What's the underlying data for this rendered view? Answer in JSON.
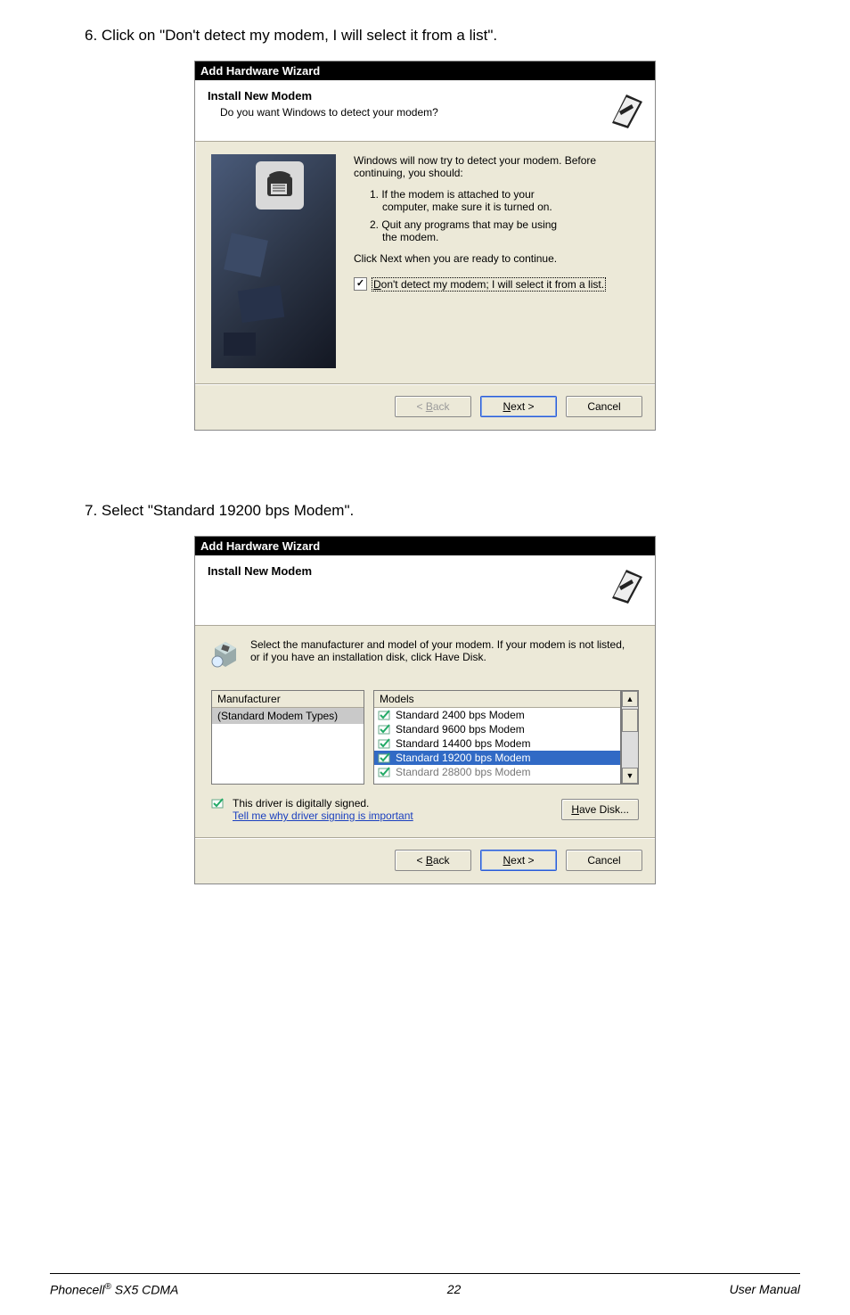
{
  "steps": {
    "s6": "6. Click on \"Don't detect my modem, I will select it from a list\".",
    "s7": "7. Select \"Standard 19200 bps Modem\"."
  },
  "dialog1": {
    "titlebar": "Add Hardware Wizard",
    "header_title": "Install New Modem",
    "header_sub": "Do you want Windows to detect your modem?",
    "intro": "Windows will now try to detect your modem.  Before continuing, you should:",
    "bullet1_a": "1.  If the modem is attached to your",
    "bullet1_b": "computer, make sure it is turned on.",
    "bullet2_a": "2.  Quit any programs that may be using",
    "bullet2_b": "the modem.",
    "ready": "Click Next when you are ready to continue.",
    "checkbox_pre": "D",
    "checkbox_rest": "on't detect my modem; I will select it from a list.",
    "back_pre": "< ",
    "back_u": "B",
    "back_rest": "ack",
    "next_u": "N",
    "next_rest": "ext >",
    "cancel": "Cancel"
  },
  "dialog2": {
    "titlebar": "Add Hardware Wizard",
    "header_title": "Install New Modem",
    "instr": "Select the manufacturer and model of your modem. If your modem is not listed, or if you have an installation disk, click Have Disk.",
    "mfr_header": "Manufacturer",
    "mfr_item": "(Standard Modem Types)",
    "models_header": "Models",
    "models": [
      "Standard  2400 bps Modem",
      "Standard  9600 bps Modem",
      "Standard 14400 bps Modem",
      "Standard 19200 bps Modem",
      "Standard 28800 bps Modem"
    ],
    "signed": "This driver is digitally signed.",
    "signed_link": "Tell me why driver signing is important",
    "have_disk_u": "H",
    "have_disk_rest": "ave Disk...",
    "back_pre": "< ",
    "back_u": "B",
    "back_rest": "ack",
    "next_u": "N",
    "next_rest": "ext >",
    "cancel": "Cancel"
  },
  "footer": {
    "left_brand": "Phonecell",
    "left_reg": "®",
    "left_model": " SX5 CDMA",
    "page": "22",
    "right": "User Manual"
  }
}
